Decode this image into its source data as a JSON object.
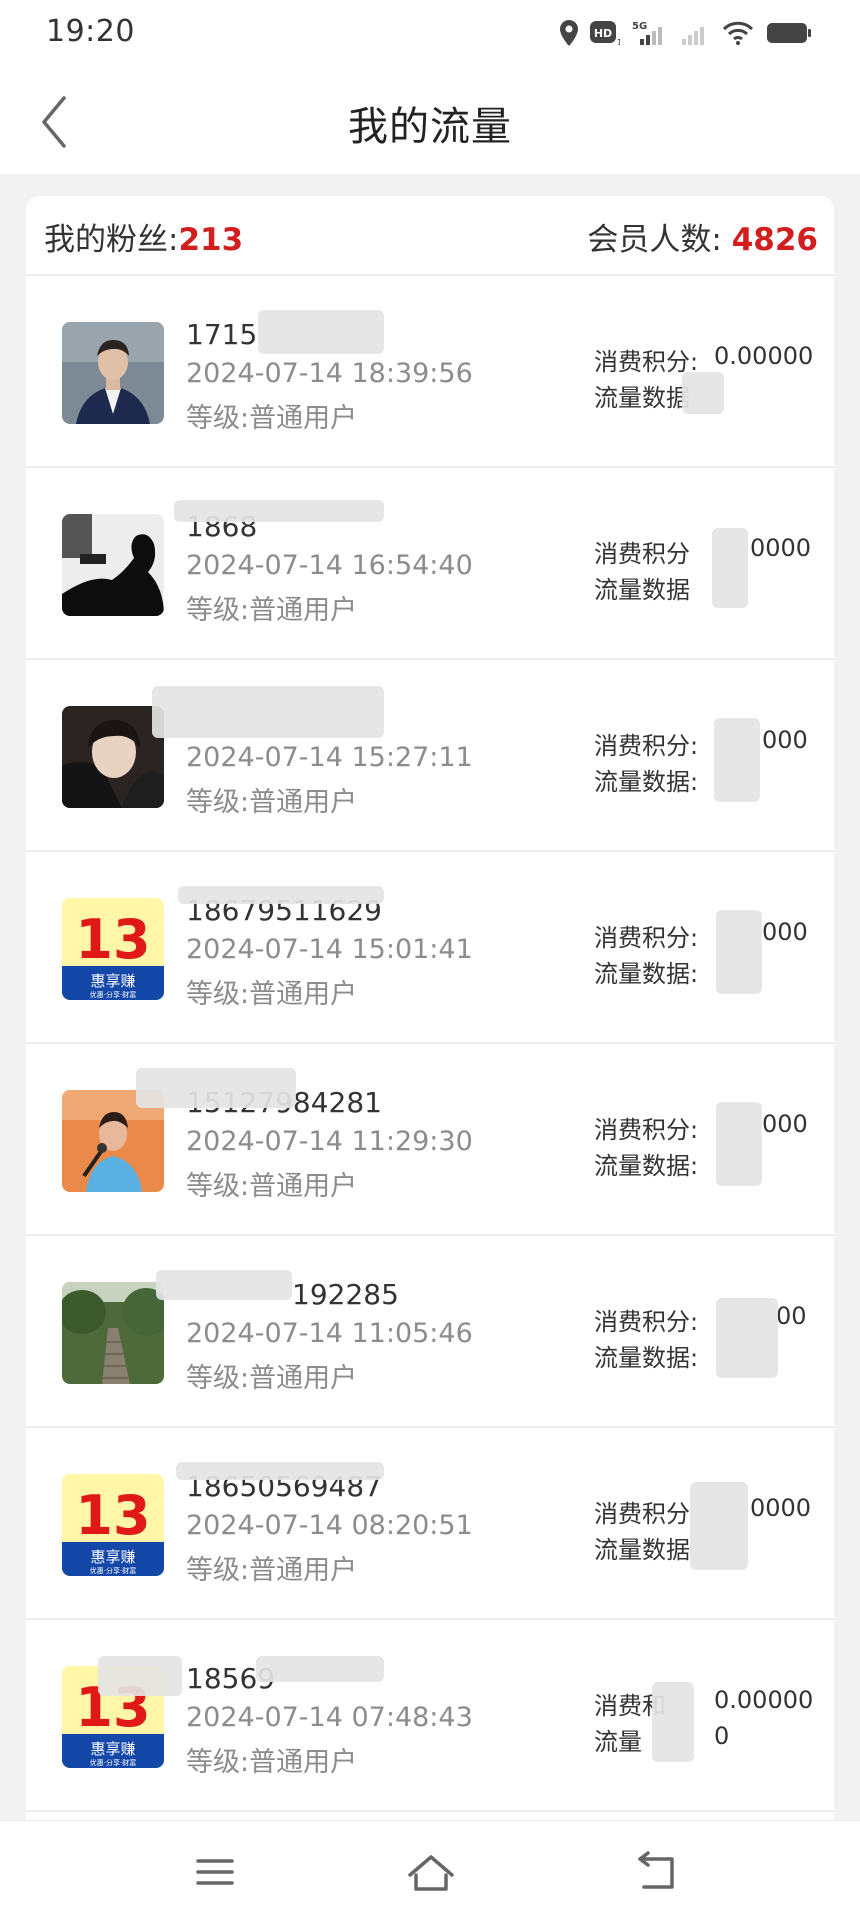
{
  "status_bar": {
    "time": "19:20",
    "icons": [
      "location-icon",
      "hd-icon",
      "5g-signal-icon",
      "signal-icon",
      "wifi-icon",
      "battery-icon"
    ]
  },
  "header": {
    "title": "我的流量",
    "back_icon": "chevron-left-icon"
  },
  "summary": {
    "fans_label": "我的粉丝:",
    "fans_value": "213",
    "members_label": "会员人数:",
    "members_value": "4826"
  },
  "rows": [
    {
      "phone": "1715",
      "time": "2024-07-14 18:39:56",
      "level": "等级:普通用户",
      "points_label": "消费积分:",
      "points_value": "0.00000",
      "traffic_label": "流量数据",
      "traffic_value": ""
    },
    {
      "phone": "1868",
      "time": "2024-07-14 16:54:40",
      "level": "等级:普通用户",
      "points_label": "消费积分",
      "points_value": "0000",
      "traffic_label": "流量数据",
      "traffic_value": ""
    },
    {
      "phone": "",
      "time": "2024-07-14 15:27:11",
      "level": "等级:普通用户",
      "points_label": "消费积分:",
      "points_value": "000",
      "traffic_label": "流量数据:",
      "traffic_value": ""
    },
    {
      "phone": "18679511629",
      "time": "2024-07-14 15:01:41",
      "level": "等级:普通用户",
      "points_label": "消费积分:",
      "points_value": "000",
      "traffic_label": "流量数据:",
      "traffic_value": ""
    },
    {
      "phone": "15127984281",
      "time": "2024-07-14 11:29:30",
      "level": "等级:普通用户",
      "points_label": "消费积分:",
      "points_value": "000",
      "traffic_label": "流量数据:",
      "traffic_value": ""
    },
    {
      "phone": "192285",
      "time": "2024-07-14 11:05:46",
      "level": "等级:普通用户",
      "points_label": "消费积分:",
      "points_value": "00",
      "traffic_label": "流量数据:",
      "traffic_value": ""
    },
    {
      "phone": "18650569487",
      "time": "2024-07-14 08:20:51",
      "level": "等级:普通用户",
      "points_label": "消费积分",
      "points_value": "0000",
      "traffic_label": "流量数据",
      "traffic_value": ""
    },
    {
      "phone": "18569",
      "time": "2024-07-14 07:48:43",
      "level": "等级:普通用户",
      "points_label": "消费和",
      "points_value": "0.00000",
      "traffic_label": "流量",
      "traffic_value": "0"
    }
  ],
  "avatars": [
    "photo-man-suit",
    "silhouette",
    "photo-young-man",
    "app-logo-13",
    "photo-singer",
    "photo-stairs",
    "app-logo-13",
    "app-logo-13"
  ],
  "logo": {
    "number": "13",
    "text": "惠享赚",
    "slogan": "优惠·分享·财富"
  },
  "bottom_nav": [
    "menu-icon",
    "home-icon",
    "back-icon"
  ],
  "colors": {
    "accent": "#d21e1e",
    "muted": "#8c8c8c",
    "background": "#f2f2f2"
  }
}
